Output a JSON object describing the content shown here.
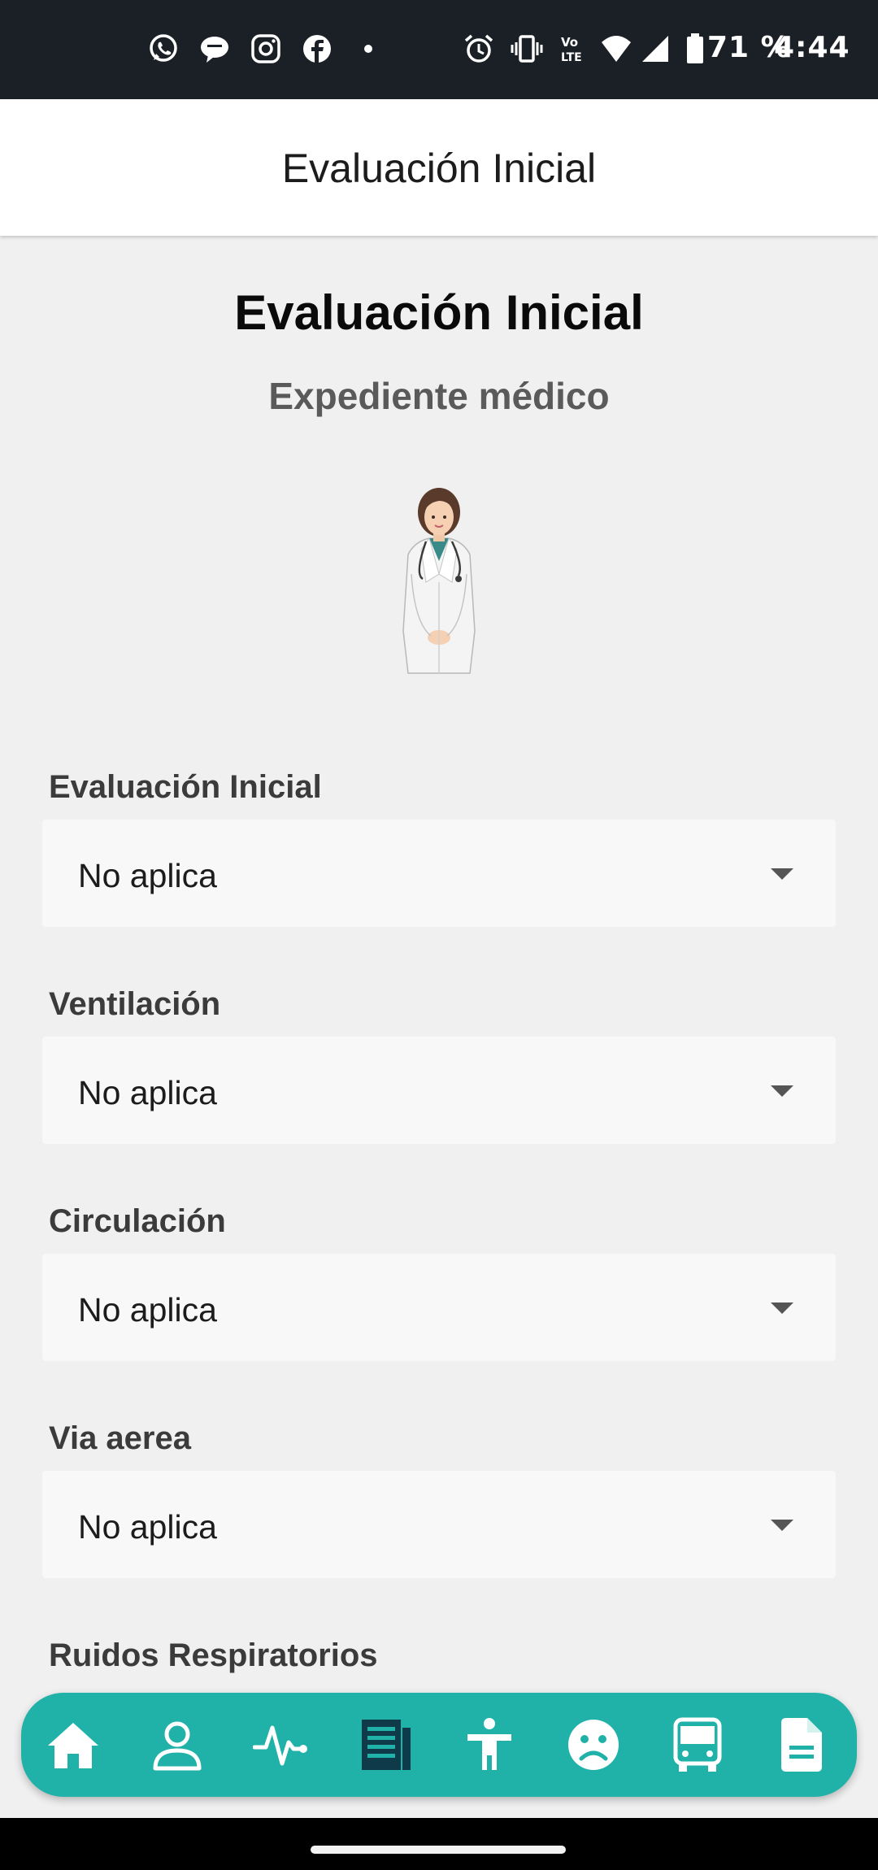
{
  "status_bar": {
    "notification_icons": [
      "whatsapp-icon",
      "chat-bubble-icon",
      "instagram-icon",
      "facebook-icon",
      "dot-icon"
    ],
    "system_icons": [
      "alarm-icon",
      "vibrate-icon",
      "volte-icon",
      "wifi-icon",
      "signal-icon",
      "battery-icon"
    ],
    "battery": "71 %",
    "time": "4:44"
  },
  "app_bar": {
    "title": "Evaluación Inicial"
  },
  "header": {
    "title": "Evaluación Inicial",
    "subtitle": "Expediente médico",
    "illustration": "doctor-illustration"
  },
  "form": {
    "fields": [
      {
        "label": "Evaluación Inicial",
        "value": "No aplica"
      },
      {
        "label": "Ventilación",
        "value": "No aplica"
      },
      {
        "label": "Circulación",
        "value": "No aplica"
      },
      {
        "label": "Via aerea",
        "value": "No aplica"
      },
      {
        "label": "Ruidos Respiratorios"
      }
    ]
  },
  "bottom_nav": {
    "items": [
      {
        "icon": "home-icon",
        "active": false
      },
      {
        "icon": "person-icon",
        "active": false
      },
      {
        "icon": "pulse-icon",
        "active": false
      },
      {
        "icon": "newspaper-icon",
        "active": true
      },
      {
        "icon": "accessibility-icon",
        "active": false
      },
      {
        "icon": "sad-face-icon",
        "active": false
      },
      {
        "icon": "bus-icon",
        "active": false
      },
      {
        "icon": "document-icon",
        "active": false
      }
    ]
  },
  "colors": {
    "status_bar_bg": "#1b1f26",
    "nav_bg": "#20b2a8",
    "nav_icon": "#ffffff",
    "nav_icon_active": "#0f3a4a",
    "page_bg": "#f0f0f0",
    "field_bg": "#f8f8f8"
  }
}
